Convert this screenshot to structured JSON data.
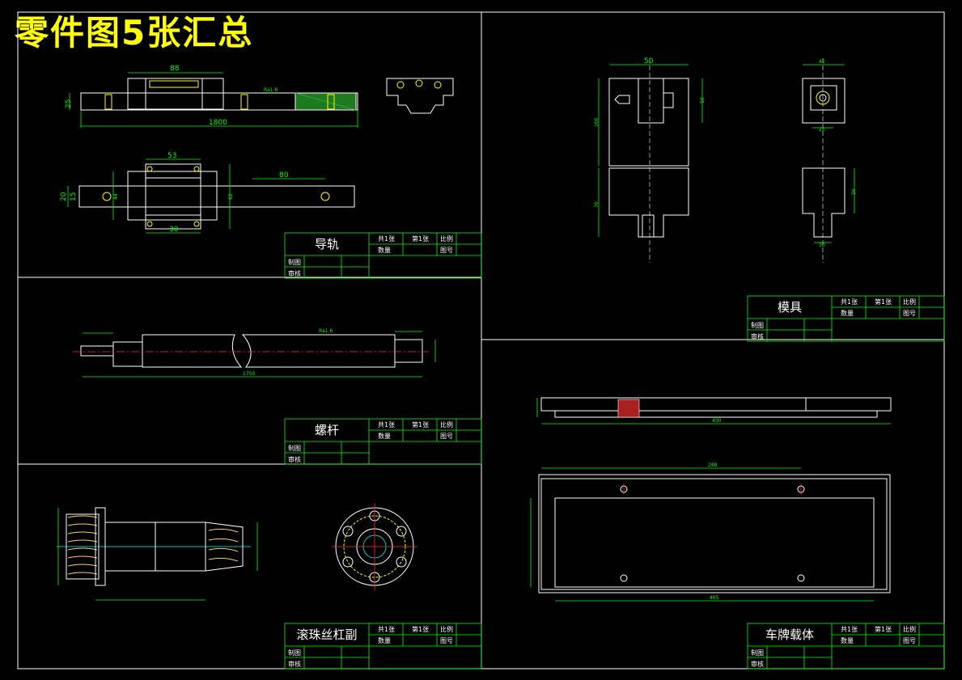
{
  "sheet_title": "零件图5张汇总",
  "title_block_labels": {
    "sheet_count": "共1张",
    "sheet_no": "第1张",
    "scale": "比例",
    "quantity": "数量",
    "drawing_no": "图号",
    "drawn": "制图",
    "checked": "审核"
  },
  "parts": [
    {
      "name": "导轨",
      "dimensions": [
        "88",
        "25",
        "1800",
        "53",
        "80",
        "20",
        "15",
        "44",
        "62",
        "30"
      ],
      "roughness": "Ra1.6"
    },
    {
      "name": "模具",
      "dimensions": [
        "50",
        "50",
        "100",
        "70",
        "45",
        "25",
        "50",
        "30"
      ]
    },
    {
      "name": "螺杆",
      "dimensions": [
        "1750"
      ],
      "roughness": "Ra1.6"
    },
    {
      "name": "滚珠丝杠副"
    },
    {
      "name": "车牌载体",
      "dimensions": [
        "450",
        "288",
        "465"
      ]
    }
  ],
  "colors": {
    "background": "#000000",
    "outline": "#ffffff",
    "dimension": "#00ff00",
    "hidden": "#ff3030",
    "title": "#ffff00"
  }
}
